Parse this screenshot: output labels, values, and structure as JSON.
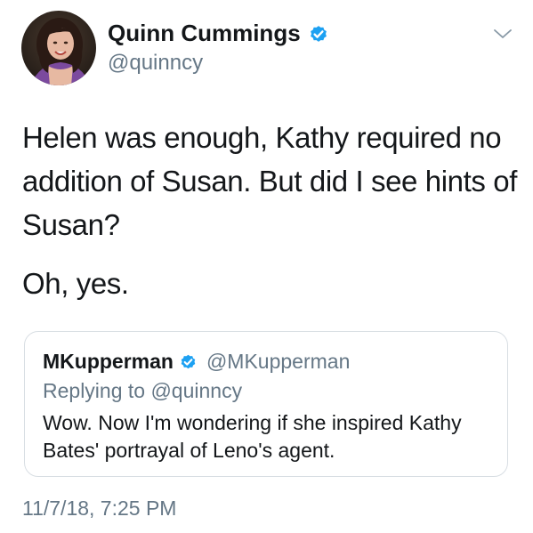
{
  "author": {
    "name": "Quinn Cummings",
    "handle": "@quinncy"
  },
  "tweet": {
    "paragraphs": [
      "Helen was enough, Kathy required no addition of Susan. But did I see hints of Susan?",
      "Oh, yes."
    ],
    "timestamp": "11/7/18, 7:25 PM"
  },
  "quoted_tweet": {
    "name": "MKupperman",
    "handle": "@MKupperman",
    "reply_context": "Replying to @quinncy",
    "text": "Wow. Now I'm wondering if she inspired Kathy Bates' portrayal of Leno's agent."
  },
  "icons": {
    "verified": "verified-badge-icon",
    "menu": "chevron-down-icon"
  },
  "colors": {
    "text_primary": "#14171a",
    "text_secondary": "#657786",
    "verified_blue": "#1da1f2",
    "card_border": "#d8dee3"
  }
}
